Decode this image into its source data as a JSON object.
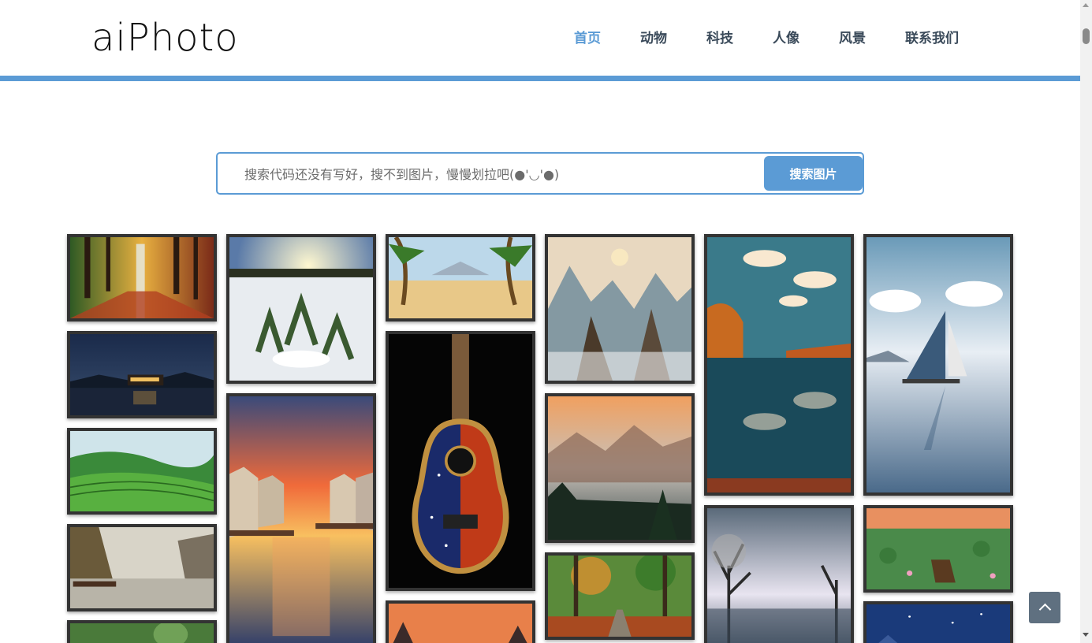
{
  "header": {
    "logo": "aiPhoto",
    "nav": [
      {
        "label": "首页",
        "active": true
      },
      {
        "label": "动物",
        "active": false
      },
      {
        "label": "科技",
        "active": false
      },
      {
        "label": "人像",
        "active": false
      },
      {
        "label": "风景",
        "active": false
      },
      {
        "label": "联系我们",
        "active": false
      }
    ]
  },
  "search": {
    "placeholder": "搜索代码还没有写好，搜不到图片，慢慢划拉吧(●'◡'●)",
    "value": "",
    "button_label": "搜索图片"
  },
  "gallery": {
    "tiles": [
      {
        "name": "forest-waterfall-photo"
      },
      {
        "name": "night-lake-cabin-photo"
      },
      {
        "name": "green-terrace-hills-photo"
      },
      {
        "name": "river-cliffs-photo"
      },
      {
        "name": "forest-partial-photo"
      },
      {
        "name": "snow-flowers-sunrise-photo"
      },
      {
        "name": "sunset-canal-houses-photo"
      },
      {
        "name": "desert-palms-photo"
      },
      {
        "name": "galaxy-guitar-photo"
      },
      {
        "name": "orange-sky-partial-photo"
      },
      {
        "name": "misty-mountains-photo"
      },
      {
        "name": "sunset-valley-mist-photo"
      },
      {
        "name": "autumn-forest-road-photo"
      },
      {
        "name": "lake-reflection-clouds-photo"
      },
      {
        "name": "winter-trees-lake-photo"
      },
      {
        "name": "sailboat-lake-photo"
      },
      {
        "name": "lotus-pond-boat-photo"
      },
      {
        "name": "starry-night-partial-photo"
      }
    ]
  },
  "back_to_top": {
    "icon": "chevron-up-icon"
  },
  "colors": {
    "accent": "#5b9bd5",
    "nav_text": "#3a4a5a",
    "tile_border": "#333333"
  }
}
